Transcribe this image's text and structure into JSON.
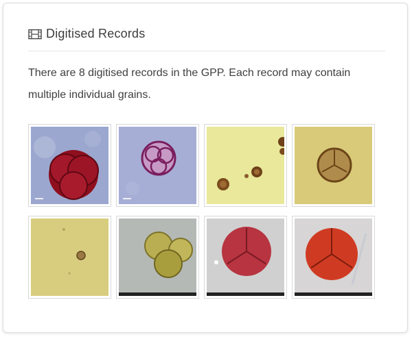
{
  "section": {
    "title": "Digitised Records",
    "icon": "film-icon"
  },
  "description": "There are 8 digitised records in the GPP. Each record may contain multiple individual grains.",
  "records": [
    {
      "name": "record-1",
      "bg": "#9aa6cf",
      "grain": "#8a1020",
      "style": "large-red-tetrad"
    },
    {
      "name": "record-2",
      "bg": "#a6aed6",
      "grain": "#8a2a6a",
      "style": "purple-outline-tetrad"
    },
    {
      "name": "record-3",
      "bg": "#e8e69a",
      "grain": "#7a4a1c",
      "style": "several-small-brown"
    },
    {
      "name": "record-4",
      "bg": "#d9cb7a",
      "grain": "#8a5a24",
      "style": "single-brown-tetrad"
    },
    {
      "name": "record-5",
      "bg": "#d8cd7e",
      "grain": "#8a6a3a",
      "style": "tiny-grain"
    },
    {
      "name": "record-6",
      "bg": "#b3b8b6",
      "grain": "#a89a3a",
      "style": "yellow-cluster"
    },
    {
      "name": "record-7",
      "bg": "#cfcfcf",
      "grain": "#b8323c",
      "style": "red-tetrad-grey"
    },
    {
      "name": "record-8",
      "bg": "#d6d4d4",
      "grain": "#cc3a22",
      "style": "orange-red-tetrad"
    }
  ]
}
